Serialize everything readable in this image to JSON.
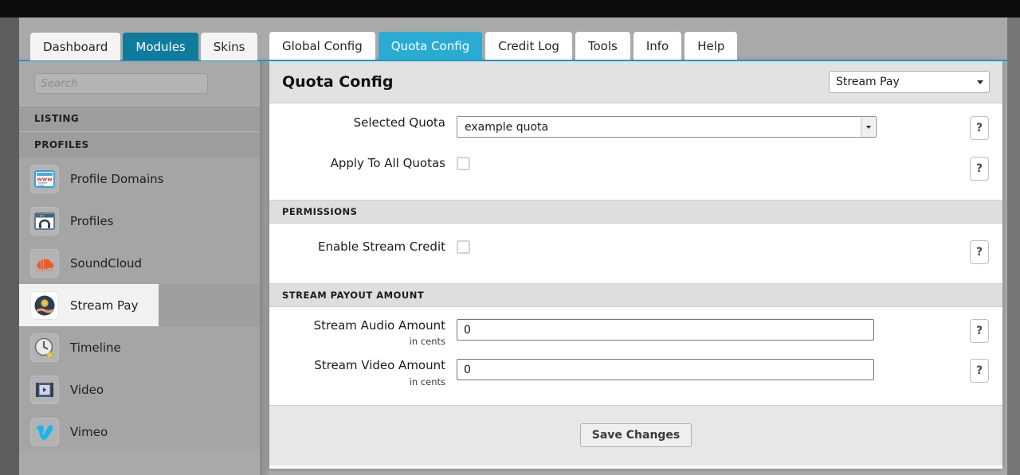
{
  "topnav": {
    "tabs": [
      {
        "label": "Dashboard",
        "active": false
      },
      {
        "label": "Modules",
        "active": true
      },
      {
        "label": "Skins",
        "active": false
      }
    ]
  },
  "sidebar": {
    "search": {
      "value": "",
      "placeholder": "Search"
    },
    "sections": [
      {
        "title": "LISTING",
        "items": []
      },
      {
        "title": "PROFILES",
        "items": [
          {
            "label": "Profile Domains",
            "icon": "browser-www-icon",
            "selected": false
          },
          {
            "label": "Profiles",
            "icon": "browser-headphones-icon",
            "selected": false
          },
          {
            "label": "SoundCloud",
            "icon": "soundcloud-cloud-icon",
            "selected": false
          },
          {
            "label": "Stream Pay",
            "icon": "coin-hand-icon",
            "selected": true
          },
          {
            "label": "Timeline",
            "icon": "clock-star-icon",
            "selected": false
          },
          {
            "label": "Video",
            "icon": "film-play-icon",
            "selected": false
          },
          {
            "label": "Vimeo",
            "icon": "vimeo-v-icon",
            "selected": false
          }
        ]
      }
    ]
  },
  "panel": {
    "tabs": [
      {
        "label": "Global Config",
        "active": false
      },
      {
        "label": "Quota Config",
        "active": true
      },
      {
        "label": "Credit Log",
        "active": false
      },
      {
        "label": "Tools",
        "active": false
      },
      {
        "label": "Info",
        "active": false
      },
      {
        "label": "Help",
        "active": false
      }
    ],
    "title": "Quota Config",
    "module_select": {
      "value": "Stream Pay"
    },
    "help_label": "?",
    "rows": {
      "selected_quota": {
        "label": "Selected Quota",
        "value": "example quota"
      },
      "apply_all": {
        "label": "Apply To All Quotas",
        "checked": false
      },
      "enable_stream_credit": {
        "label": "Enable Stream Credit",
        "checked": false
      },
      "stream_audio": {
        "label": "Stream Audio Amount",
        "sublabel": "in cents",
        "value": "0"
      },
      "stream_video": {
        "label": "Stream Video Amount",
        "sublabel": "in cents",
        "value": "0"
      }
    },
    "sections": {
      "permissions": "PERMISSIONS",
      "payout": "STREAM PAYOUT AMOUNT"
    },
    "save_label": "Save Changes"
  },
  "colors": {
    "topnav_active": "#0e7c9e",
    "panel_tab_active": "#29abd3",
    "accent_rule": "#2196c4",
    "page_bg": "#a9a9a9"
  }
}
